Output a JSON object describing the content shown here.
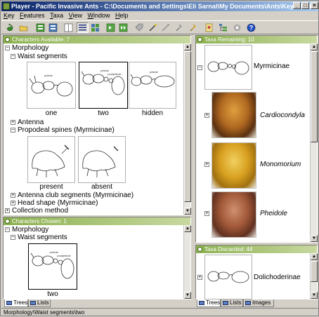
{
  "window": {
    "title": "Player - Pacific Invasive Ants - C:\\Documents and Settings\\Eli Sarnat\\My Documents\\Ants\\Keys\\PIAkey\\PIAke..."
  },
  "title_buttons": {
    "minimize": "_",
    "maximize": "□",
    "close": "×"
  },
  "menu": [
    {
      "label": "Key",
      "u": "K"
    },
    {
      "label": "Features",
      "u": "F"
    },
    {
      "label": "Taxa",
      "u": "T"
    },
    {
      "label": "View",
      "u": "V"
    },
    {
      "label": "Window",
      "u": "W"
    },
    {
      "label": "Help",
      "u": "H"
    }
  ],
  "toolbar_icons": [
    "restart-icon",
    "open-icon",
    "features-icon",
    "taxa-icon",
    "split-icon",
    "list-view-icon",
    "thumbnail-view-icon",
    "go-icon",
    "go-again-icon",
    "tag-icon",
    "wand-icon",
    "clear-icon",
    "pin-icon",
    "pin2-icon",
    "bookmark-icon",
    "tree-icon",
    "tools-icon",
    "help-icon"
  ],
  "colors": {
    "header_green": "#8bb04f",
    "titlebar": "#0a246a",
    "tab_blue": "#5a7fc0"
  },
  "available": {
    "header": "Characters Available: 7",
    "morphology": "Morphology",
    "waist": "Waist segments",
    "waist_states": [
      "one",
      "two",
      "hidden"
    ],
    "antenna": "Antenna",
    "propodeal": "Propodeal spines (Myrmicinae)",
    "propodeal_states": [
      "present",
      "absent"
    ],
    "antenna_club": "Antenna club segments (Myrmicinae)",
    "head_shape": "Head shape (Myrmicinae)",
    "collection": "Collection method"
  },
  "chosen": {
    "header": "Characters Chosen: 1",
    "morphology": "Morphology",
    "waist": "Waist segments",
    "state": "two"
  },
  "left_tabs": [
    "Trees",
    "Lists"
  ],
  "remaining": {
    "header": "Taxa Remaining: 10",
    "group": "Myrmicinae",
    "taxa": [
      "Cardiocondyla",
      "Monomorium",
      "Pheidole"
    ]
  },
  "discarded": {
    "header": "Taxa Discarded: 44",
    "group": "Dolichoderinae"
  },
  "right_tabs": [
    "Trees",
    "Lists",
    "Images"
  ],
  "status": "Morphology\\Waist segments\\two"
}
